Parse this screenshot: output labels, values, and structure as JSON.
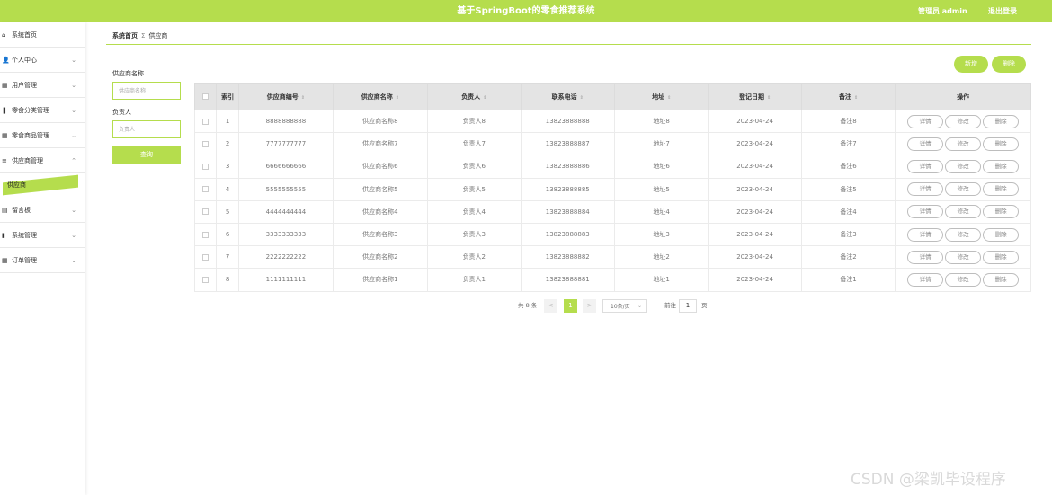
{
  "header": {
    "title": "基于SpringBoot的零食推荐系统",
    "user": "管理员 admin",
    "logout": "退出登录"
  },
  "sidebar": {
    "items": [
      {
        "label": "系统首页",
        "icon": "home-icon",
        "glyph": "⌂",
        "chevron": false
      },
      {
        "label": "个人中心",
        "icon": "person-icon",
        "glyph": "👤",
        "chevron": true
      },
      {
        "label": "用户管理",
        "icon": "grid-icon",
        "glyph": "▦",
        "chevron": true
      },
      {
        "label": "零食分类管理",
        "icon": "category-icon",
        "glyph": "❚",
        "chevron": true
      },
      {
        "label": "零食商品管理",
        "icon": "grid-icon",
        "glyph": "▦",
        "chevron": true
      },
      {
        "label": "供应商管理",
        "icon": "list-icon",
        "glyph": "≡",
        "chevron": true,
        "expanded": true
      },
      {
        "label": "留言板",
        "icon": "message-icon",
        "glyph": "▤",
        "chevron": true
      },
      {
        "label": "系统管理",
        "icon": "chart-icon",
        "glyph": "▮",
        "chevron": true
      },
      {
        "label": "订单管理",
        "icon": "grid-icon",
        "glyph": "▦",
        "chevron": true
      }
    ],
    "active_sub": "供应商"
  },
  "breadcrumb": {
    "home": "系统首页",
    "sep": "Σ",
    "current": "供应商"
  },
  "search": {
    "name_label": "供应商名称",
    "name_placeholder": "供应商名称",
    "person_label": "负责人",
    "person_placeholder": "负责人",
    "button": "查询"
  },
  "actions": {
    "add": "新增",
    "delete": "删除"
  },
  "table": {
    "columns": [
      "索引",
      "供应商编号",
      "供应商名称",
      "负责人",
      "联系电话",
      "地址",
      "登记日期",
      "备注",
      "操作"
    ],
    "rows": [
      [
        "1",
        "8888888888",
        "供应商名称8",
        "负责人8",
        "13823888888",
        "地址8",
        "2023-04-24",
        "备注8"
      ],
      [
        "2",
        "7777777777",
        "供应商名称7",
        "负责人7",
        "13823888887",
        "地址7",
        "2023-04-24",
        "备注7"
      ],
      [
        "3",
        "6666666666",
        "供应商名称6",
        "负责人6",
        "13823888886",
        "地址6",
        "2023-04-24",
        "备注6"
      ],
      [
        "4",
        "5555555555",
        "供应商名称5",
        "负责人5",
        "13823888885",
        "地址5",
        "2023-04-24",
        "备注5"
      ],
      [
        "5",
        "4444444444",
        "供应商名称4",
        "负责人4",
        "13823888884",
        "地址4",
        "2023-04-24",
        "备注4"
      ],
      [
        "6",
        "3333333333",
        "供应商名称3",
        "负责人3",
        "13823888883",
        "地址3",
        "2023-04-24",
        "备注3"
      ],
      [
        "7",
        "2222222222",
        "供应商名称2",
        "负责人2",
        "13823888882",
        "地址2",
        "2023-04-24",
        "备注2"
      ],
      [
        "8",
        "1111111111",
        "供应商名称1",
        "负责人1",
        "13823888881",
        "地址1",
        "2023-04-24",
        "备注1"
      ]
    ],
    "row_actions": [
      "详情",
      "修改",
      "删除"
    ]
  },
  "pagination": {
    "total": "共 8 条",
    "prev": "<",
    "current_page": "1",
    "next": ">",
    "page_size": "10条/页",
    "goto_prefix": "前往",
    "goto_value": "1",
    "goto_suffix": "页"
  },
  "watermark": "CSDN @梁凯毕设程序",
  "colors": {
    "accent": "#b5dd4d"
  }
}
